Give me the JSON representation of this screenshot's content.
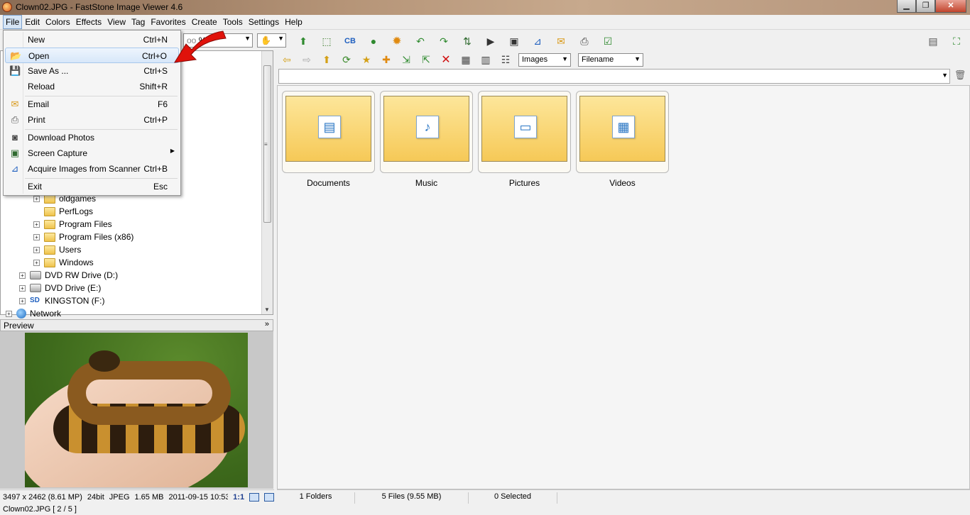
{
  "window": {
    "title": "Clown02.JPG  -  FastStone Image Viewer 4.6"
  },
  "menubar": {
    "items": [
      "File",
      "Edit",
      "Colors",
      "Effects",
      "View",
      "Tag",
      "Favorites",
      "Create",
      "Tools",
      "Settings",
      "Help"
    ]
  },
  "toolbar": {
    "zoom_value": "%"
  },
  "file_menu": {
    "items": [
      {
        "label": "New",
        "shortcut": "Ctrl+N"
      },
      {
        "label": "Open",
        "shortcut": "Ctrl+O"
      },
      {
        "label": "Save As ...",
        "shortcut": "Ctrl+S"
      },
      {
        "label": "Reload",
        "shortcut": "Shift+R"
      },
      {
        "label": "Email",
        "shortcut": "F6"
      },
      {
        "label": "Print",
        "shortcut": "Ctrl+P"
      },
      {
        "label": "Download Photos",
        "shortcut": ""
      },
      {
        "label": "Screen Capture",
        "shortcut": ""
      },
      {
        "label": "Acquire Images from Scanner",
        "shortcut": "Ctrl+B"
      },
      {
        "label": "Exit",
        "shortcut": "Esc"
      }
    ]
  },
  "tree": {
    "items": [
      {
        "label": "oldgames"
      },
      {
        "label": "PerfLogs"
      },
      {
        "label": "Program Files"
      },
      {
        "label": "Program Files (x86)"
      },
      {
        "label": "Users"
      },
      {
        "label": "Windows"
      },
      {
        "label": "DVD RW Drive (D:)"
      },
      {
        "label": "DVD Drive (E:)"
      },
      {
        "label": "KINGSTON (F:)"
      },
      {
        "label": "Network"
      }
    ]
  },
  "filters": {
    "type": "Images",
    "sort": "Filename"
  },
  "address": {
    "value": ""
  },
  "preview": {
    "header": "Preview"
  },
  "thumbnails": [
    {
      "label": "Documents",
      "glyph": "▤"
    },
    {
      "label": "Music",
      "glyph": "♪"
    },
    {
      "label": "Pictures",
      "glyph": "▭"
    },
    {
      "label": "Videos",
      "glyph": "▦"
    }
  ],
  "image_info": {
    "dimensions": "3497 x 2462 (8.61 MP)",
    "depth": "24bit",
    "format": "JPEG",
    "size": "1.65 MB",
    "date": "2011-09-15 10:53",
    "ratio": "1:1"
  },
  "status": {
    "folders": "1 Folders",
    "files": "5 Files (9.55 MB)",
    "selected": "0 Selected",
    "bottom": "Clown02.JPG [ 2 / 5 ]"
  },
  "colors": {
    "accent_red": "#e0120b",
    "folder_yellow": "#f6c957",
    "menu_highlight": "#d7e7f9"
  }
}
